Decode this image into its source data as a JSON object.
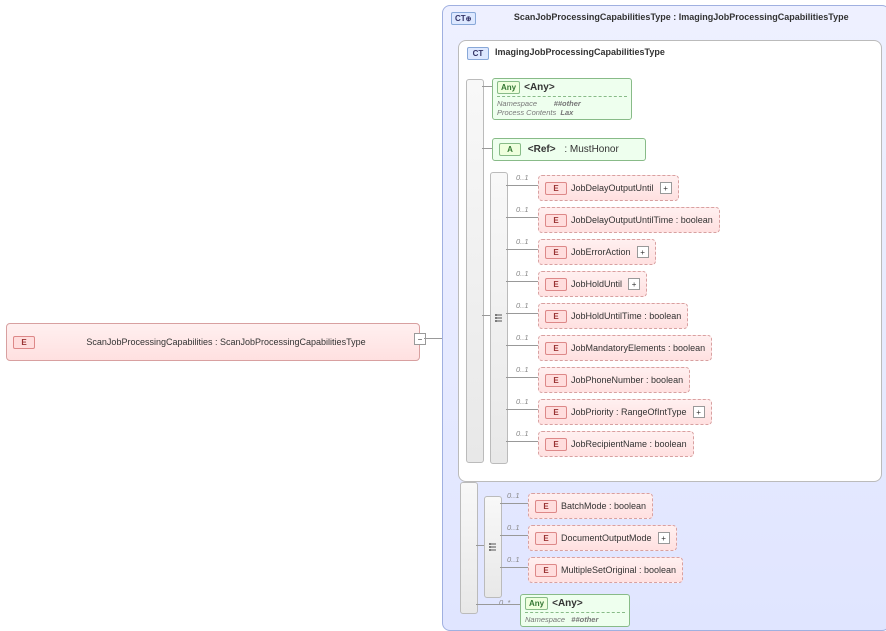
{
  "root": {
    "label": "ScanJobProcessingCapabilities : ScanJobProcessingCapabilitiesType"
  },
  "outer_ct": {
    "label": "ScanJobProcessingCapabilitiesType : ImagingJobProcessingCapabilitiesType"
  },
  "inner_ct": {
    "label": "ImagingJobProcessingCapabilitiesType"
  },
  "any1": {
    "label": "<Any>",
    "ns_label": "Namespace",
    "ns": "##other",
    "pc_label": "Process Contents",
    "pc": "Lax"
  },
  "ref": {
    "label": "<Ref>",
    "type": ": MustHonor"
  },
  "innerElems": [
    {
      "label": "JobDelayOutputUntil",
      "card": "0..1",
      "exp": true
    },
    {
      "label": "JobDelayOutputUntilTime : boolean",
      "card": "0..1"
    },
    {
      "label": "JobErrorAction",
      "card": "0..1",
      "exp": true
    },
    {
      "label": "JobHoldUntil",
      "card": "0..1",
      "exp": true
    },
    {
      "label": "JobHoldUntilTime : boolean",
      "card": "0..1"
    },
    {
      "label": "JobMandatoryElements : boolean",
      "card": "0..1"
    },
    {
      "label": "JobPhoneNumber : boolean",
      "card": "0..1"
    },
    {
      "label": "JobPriority : RangeOfIntType",
      "card": "0..1",
      "exp": true
    },
    {
      "label": "JobRecipientName : boolean",
      "card": "0..1"
    }
  ],
  "outerElems": [
    {
      "label": "BatchMode : boolean",
      "card": "0..1"
    },
    {
      "label": "DocumentOutputMode",
      "card": "0..1",
      "exp": true
    },
    {
      "label": "MultipleSetOriginal : boolean",
      "card": "0..1"
    }
  ],
  "any2": {
    "label": "<Any>",
    "ns_label": "Namespace",
    "ns": "##other",
    "card": "0..*"
  }
}
